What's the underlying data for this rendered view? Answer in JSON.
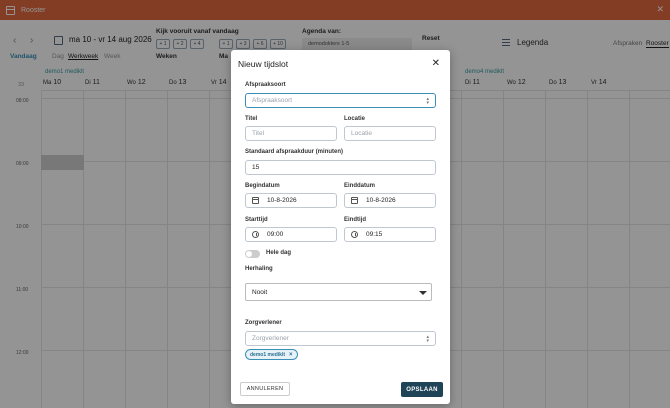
{
  "window": {
    "title": "Rooster"
  },
  "toolbar": {
    "date_range": "ma 10 - vr 14 aug 2026",
    "today": "Vandaag",
    "views": [
      "Dag",
      "Werkweek",
      "Week"
    ],
    "lookahead_label": "Kijk vooruit vanaf vandaag",
    "week_buttons": [
      "+ 1",
      "+ 2",
      "+ 4"
    ],
    "month_buttons": [
      "+ 1",
      "+ 3",
      "+ 6",
      "+ 10"
    ],
    "weeks_label": "Weken",
    "months_label": "Ma",
    "agenda_label": "Agenda van:",
    "agenda_value": "demodokters 1-5",
    "reset_label": "Reset",
    "legend_label": "Legenda",
    "modes": [
      "Afspraken",
      "Rooster"
    ]
  },
  "calendar": {
    "resources": [
      "demo1 mediklt",
      "demo4 mediklt"
    ],
    "week_number": "33",
    "days": [
      {
        "dn": "Ma",
        "d": "10"
      },
      {
        "dn": "Di",
        "d": "11"
      },
      {
        "dn": "Wo",
        "d": "12"
      },
      {
        "dn": "Do",
        "d": "13"
      },
      {
        "dn": "Vr",
        "d": "14"
      },
      {
        "dn": "Ma",
        "d": "10"
      },
      {
        "dn": "Di",
        "d": "11"
      },
      {
        "dn": "Wo",
        "d": "12"
      },
      {
        "dn": "Do",
        "d": "13"
      },
      {
        "dn": "Vr",
        "d": "14"
      }
    ],
    "hours": [
      "08:00",
      "09:00",
      "10:00",
      "11:00",
      "12:00"
    ]
  },
  "modal": {
    "title": "Nieuw tijdslot",
    "appointment_type_label": "Afspraaksoort",
    "appointment_type_placeholder": "Afspraaksoort",
    "title_label": "Titel",
    "title_placeholder": "Titel",
    "location_label": "Locatie",
    "location_placeholder": "Locatie",
    "duration_label": "Standaard afspraakduur (minuten)",
    "duration_value": "15",
    "start_date_label": "Begindatum",
    "start_date_value": "10-8-2026",
    "end_date_label": "Einddatum",
    "end_date_value": "10-8-2026",
    "start_time_label": "Starttijd",
    "start_time_value": "09:00",
    "end_time_label": "Eindtijd",
    "end_time_value": "09:15",
    "all_day_label": "Hele dag",
    "repeat_label": "Herhaling",
    "repeat_value": "Nooit",
    "caregiver_label": "Zorgverlener",
    "caregiver_placeholder": "Zorgverlener",
    "caregiver_chip": "demo1 mediklt",
    "cancel_label": "ANNULEREN",
    "save_label": "OPSLAAN"
  }
}
